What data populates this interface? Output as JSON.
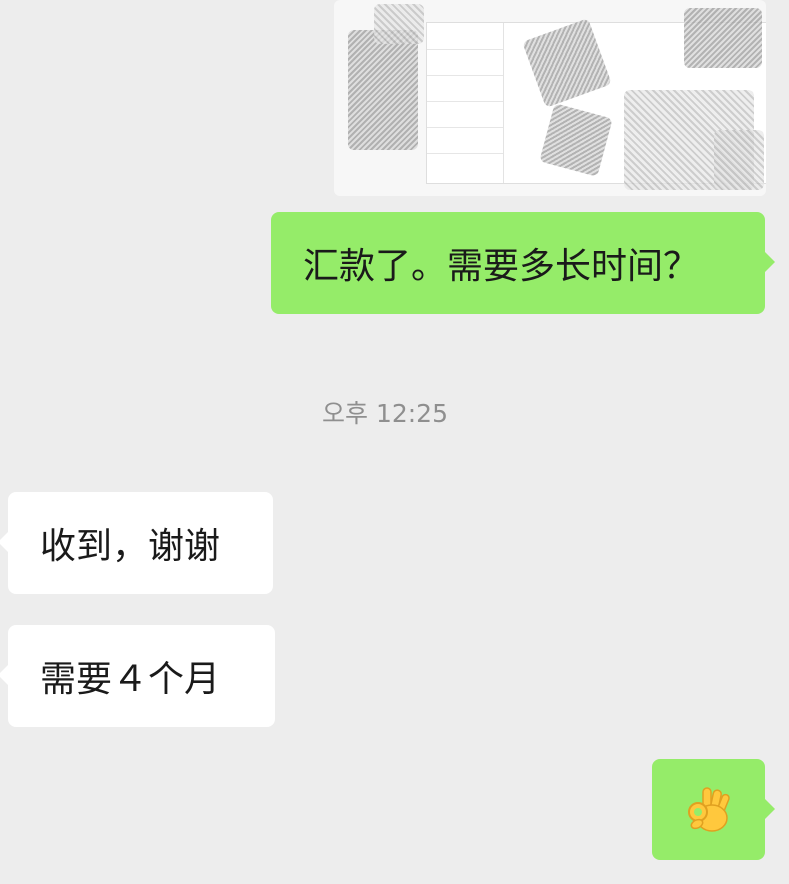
{
  "messages": [
    {
      "side": "sent",
      "type": "image"
    },
    {
      "side": "sent",
      "type": "text",
      "text": "汇款了。需要多长时间？"
    },
    {
      "type": "timestamp",
      "text": "오후 12:25"
    },
    {
      "side": "received",
      "type": "text",
      "text": "收到，谢谢"
    },
    {
      "side": "received",
      "type": "text",
      "text": "需要４个月"
    },
    {
      "side": "sent",
      "type": "emoji",
      "icon": "ok-hand-emoji-icon"
    }
  ],
  "colors": {
    "background": "#ededed",
    "sent_bubble": "#95ec69",
    "received_bubble": "#ffffff",
    "timestamp_text": "#8f8f8f"
  }
}
